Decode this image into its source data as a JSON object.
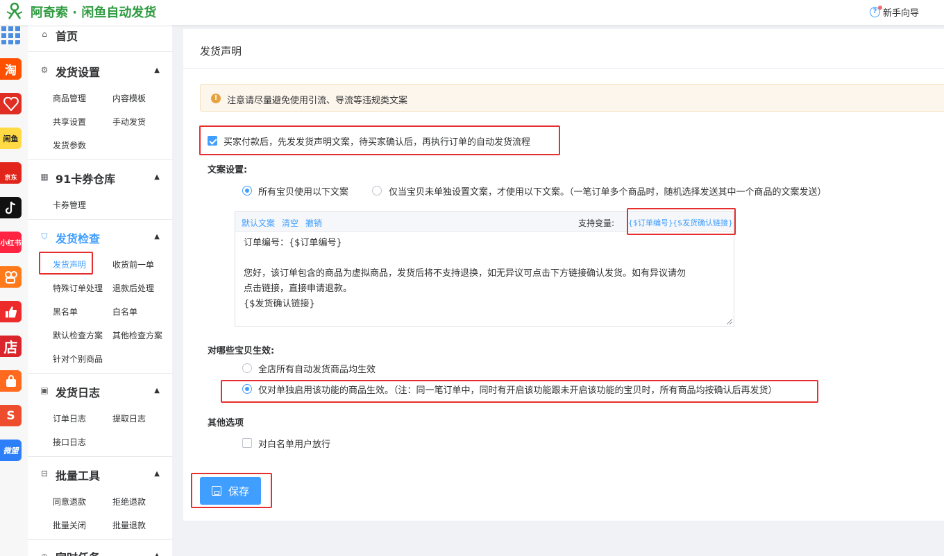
{
  "header": {
    "app_title": "阿奇索 · 闲鱼自动发货",
    "guide_label": "新手向导",
    "accent": "#2e9b3f"
  },
  "platforms": [
    {
      "icon": "grid-icon",
      "label": "",
      "color": "#4b8de0"
    },
    {
      "icon": "taobao-icon",
      "label": "淘",
      "color": "#ff5000"
    },
    {
      "icon": "pinduoduo-icon",
      "label": "",
      "color": "#e02e24"
    },
    {
      "icon": "xianyu-icon",
      "label": "闲鱼",
      "color": "#ffda44"
    },
    {
      "icon": "jd-icon",
      "label": "京东",
      "color": "#e1251b"
    },
    {
      "icon": "douyin-icon",
      "label": "",
      "color": "#111111"
    },
    {
      "icon": "xiaohongshu-icon",
      "label": "小红书",
      "color": "#ff2442"
    },
    {
      "icon": "kuaishou-icon",
      "label": "",
      "color": "#ff7a1a"
    },
    {
      "icon": "thumb-icon",
      "label": "",
      "color": "#ee2b2b"
    },
    {
      "icon": "shop-icon",
      "label": "店",
      "color": "#d9252b"
    },
    {
      "icon": "bag-icon",
      "label": "",
      "color": "#ff6a1f"
    },
    {
      "icon": "shopee-icon",
      "label": "S",
      "color": "#ee4d2d"
    },
    {
      "icon": "weimeng-icon",
      "label": "微盟",
      "color": "#2d7ff9"
    }
  ],
  "sidebar": {
    "home": "首页",
    "sections": [
      {
        "title": "发货设置",
        "items": [
          "商品管理",
          "内容模板",
          "共享设置",
          "手动发货",
          "发货参数"
        ]
      },
      {
        "title": "91卡券仓库",
        "items": [
          "卡券管理"
        ]
      },
      {
        "title": "发货检查",
        "items": [
          "发货声明",
          "收货前一单",
          "特殊订单处理",
          "退款后处理",
          "黑名单",
          "白名单",
          "默认检查方案",
          "其他检查方案",
          "针对个别商品"
        ]
      },
      {
        "title": "发货日志",
        "items": [
          "订单日志",
          "提取日志",
          "接口日志"
        ]
      },
      {
        "title": "批量工具",
        "items": [
          "同意退款",
          "拒绝退款",
          "批量关闭",
          "批量退款"
        ]
      },
      {
        "title": "定时任务"
      }
    ]
  },
  "main": {
    "title": "发货声明",
    "alert": "注意请尽量避免使用引流、导流等违规类文案",
    "enable_label": "买家付款后，先发发货声明文案，待买家确认后，再执行订单的自动发货流程",
    "copy_settings_label": "文案设置:",
    "copy_opt_all": "所有宝贝使用以下文案",
    "copy_opt_fallback": "仅当宝贝未单独设置文案，才使用以下文案。（一笔订单多个商品时，随机选择发送其中一个商品的文案发送）",
    "editor": {
      "default_link": "默认文案",
      "clear_link": "清空",
      "undo_link": "撤销",
      "vars_label": "支持变量:",
      "var_order": "{$订单编号}",
      "var_confirm": "{$发货确认链接}",
      "lines": [
        "订单编号：{$订单编号}",
        "",
        "您好，该订单包含的商品为虚拟商品，发货后将不支持退换，如无异议可点击下方链接确认发货。如有异议请勿",
        "点击链接，直接申请退款。",
        "{$发货确认链接}"
      ]
    },
    "scope_label": "对哪些宝贝生效:",
    "scope_opt_all": "全店所有自动发货商品均生效",
    "scope_opt_enabled": "仅对单独启用该功能的商品生效。（注：同一笔订单中，同时有开启该功能跟未开启该功能的宝贝时，所有商品均按确认后再发货）",
    "other_label": "其他选项",
    "whitelist_label": "对白名单用户放行",
    "save_label": "保存",
    "primary_color": "#409eff",
    "highlight_color": "#e62e2e"
  }
}
